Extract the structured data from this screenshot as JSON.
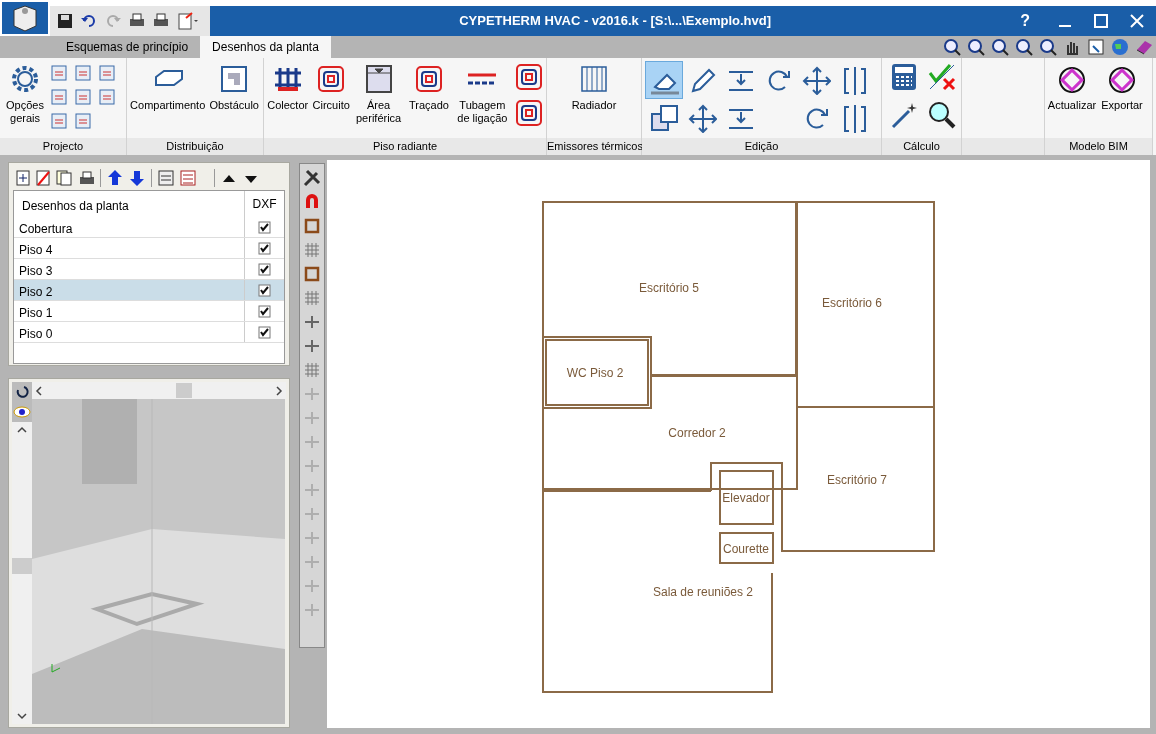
{
  "window": {
    "title": "CYPETHERM HVAC - v2016.k - [S:\\...\\Exemplo.hvd]",
    "help": "?"
  },
  "tabs": [
    {
      "label": "Esquemas de princípio",
      "selected": false
    },
    {
      "label": "Desenhos da planta",
      "selected": true
    }
  ],
  "ribbon": [
    {
      "label": "Projecto",
      "buttons": [
        {
          "label": "Opções gerais"
        }
      ]
    },
    {
      "label": "Distribuição",
      "buttons": [
        {
          "label": "Compartimento"
        },
        {
          "label": "Obstáculo"
        }
      ]
    },
    {
      "label": "Piso radiante",
      "buttons": [
        {
          "label": "Colector"
        },
        {
          "label": "Circuito"
        },
        {
          "label": "Área periférica"
        },
        {
          "label": "Traçado"
        },
        {
          "label": "Tubagem de ligação"
        }
      ]
    },
    {
      "label": "Emissores térmicos",
      "buttons": [
        {
          "label": "Radiador"
        }
      ]
    },
    {
      "label": "Edição"
    },
    {
      "label": "Cálculo"
    },
    {
      "label": "Modelo BIM",
      "buttons": [
        {
          "label": "Actualizar"
        },
        {
          "label": "Exportar"
        }
      ]
    }
  ],
  "edit_tools": [
    {
      "selected": true
    },
    {
      "selected": false
    },
    {
      "selected": false
    },
    {
      "selected": false
    },
    {
      "selected": false
    },
    {
      "selected": false
    },
    {
      "selected": false
    },
    {
      "selected": false
    },
    {
      "selected": false
    },
    {
      "selected": false
    },
    {
      "selected": false
    }
  ],
  "plans": {
    "columns": [
      "Desenhos da planta",
      "DXF"
    ],
    "rows": [
      {
        "name": "Cobertura",
        "dxf": true,
        "selected": false
      },
      {
        "name": "Piso 4",
        "dxf": true,
        "selected": false
      },
      {
        "name": "Piso 3",
        "dxf": true,
        "selected": false
      },
      {
        "name": "Piso 2",
        "dxf": true,
        "selected": true
      },
      {
        "name": "Piso 1",
        "dxf": true,
        "selected": false
      },
      {
        "name": "Piso 0",
        "dxf": true,
        "selected": false
      }
    ]
  },
  "side_tools": [
    {
      "disabled": false
    },
    {
      "disabled": false
    },
    {
      "disabled": false
    },
    {
      "disabled": false
    },
    {
      "disabled": false
    },
    {
      "disabled": false
    },
    {
      "disabled": false
    },
    {
      "disabled": false
    },
    {
      "disabled": false
    },
    {
      "disabled": true
    },
    {
      "disabled": true
    },
    {
      "disabled": true
    },
    {
      "disabled": true
    },
    {
      "disabled": true
    },
    {
      "disabled": true
    },
    {
      "disabled": true
    },
    {
      "disabled": true
    },
    {
      "disabled": true
    },
    {
      "disabled": true
    }
  ],
  "rooms": [
    {
      "label": "Escritório 5"
    },
    {
      "label": "Escritório 6"
    },
    {
      "label": "WC Piso 2"
    },
    {
      "label": "Corredor 2"
    },
    {
      "label": "Escritório 7"
    },
    {
      "label": "Elevador"
    },
    {
      "label": "Courette"
    },
    {
      "label": "Sala de reuniões 2"
    }
  ]
}
